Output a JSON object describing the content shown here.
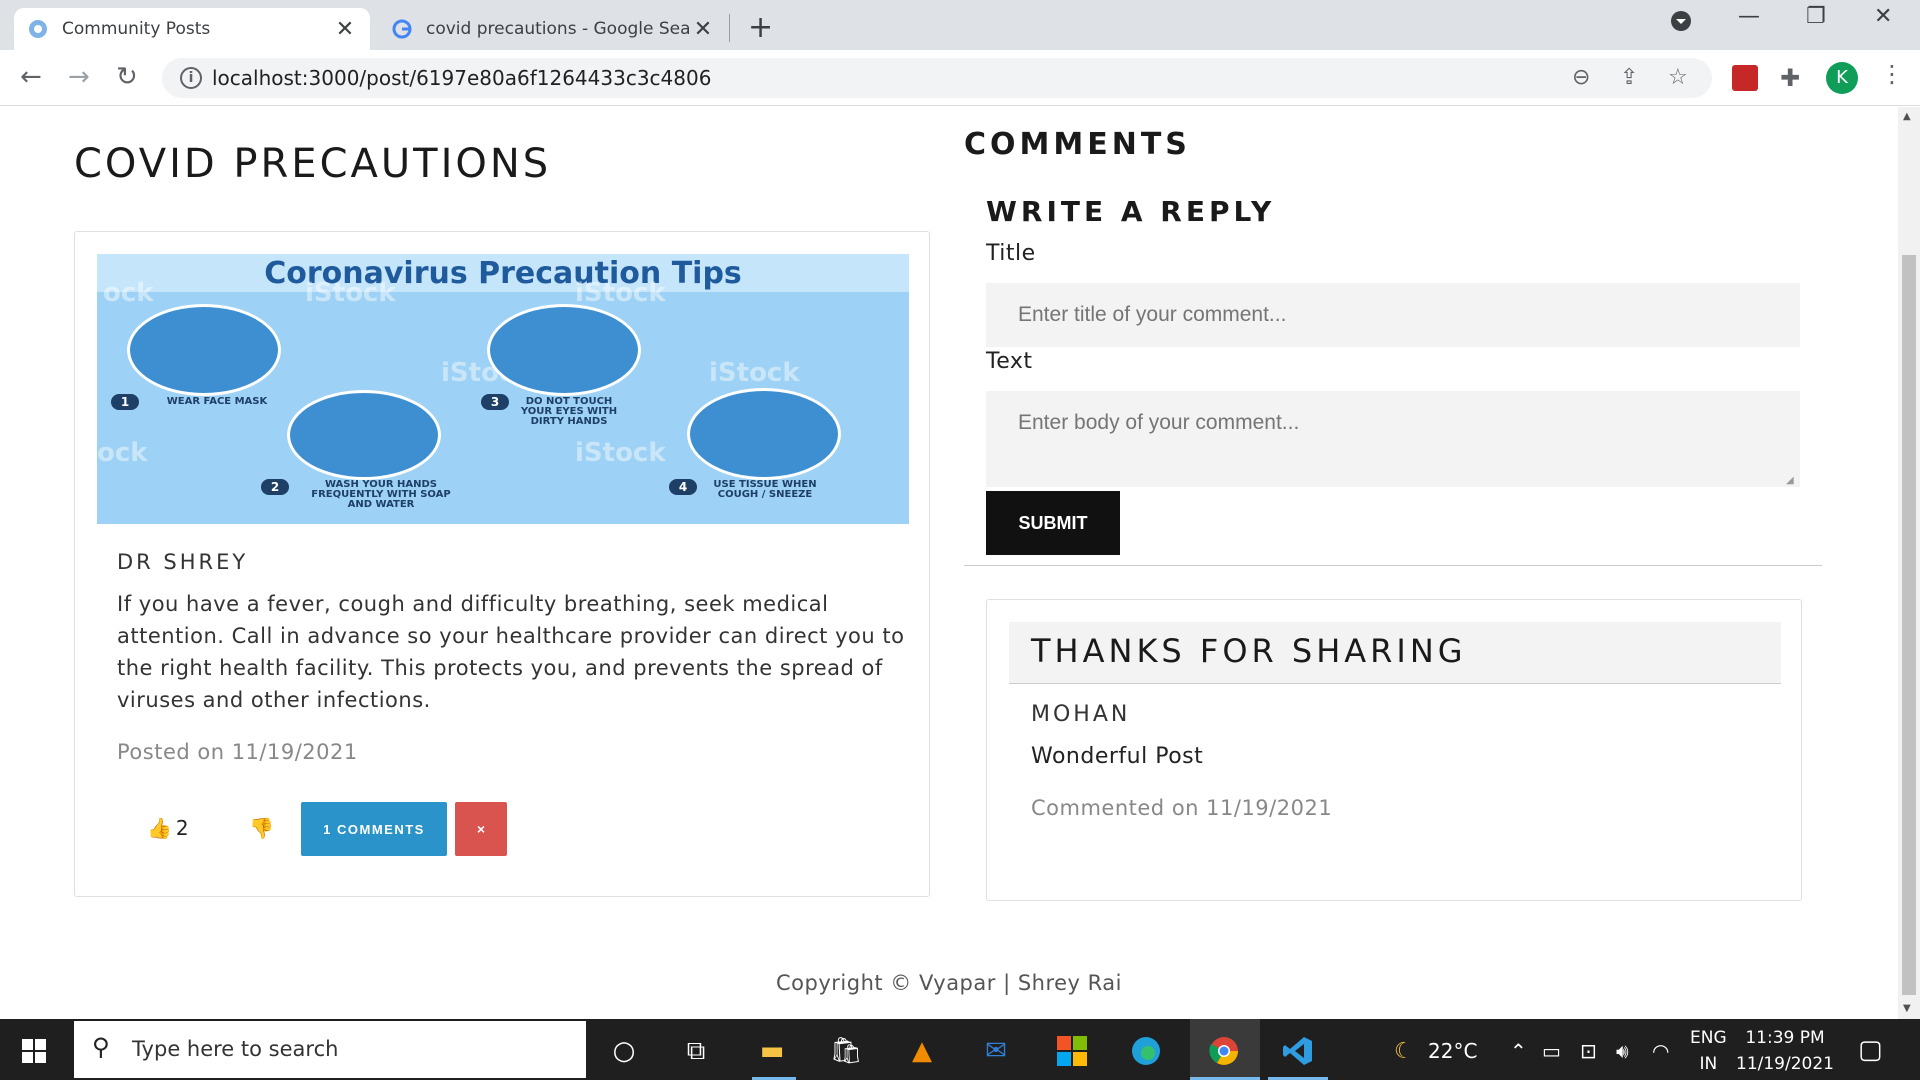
{
  "browser": {
    "tabs": [
      {
        "title": "Community Posts",
        "active": true
      },
      {
        "title": "covid precautions - Google Search",
        "active": false
      }
    ],
    "url": "localhost:3000/post/6197e80a6f1264433c3c4806",
    "profile_initial": "K"
  },
  "post": {
    "title": "COVID PRECAUTIONS",
    "image": {
      "heading": "Coronavirus Precaution Tips",
      "tips": [
        {
          "num": "1",
          "label": "WEAR FACE MASK"
        },
        {
          "num": "2",
          "label": "WASH YOUR HANDS FREQUENTLY WITH SOAP AND WATER"
        },
        {
          "num": "3",
          "label": "DO NOT TOUCH YOUR EYES WITH DIRTY HANDS"
        },
        {
          "num": "4",
          "label": "USE TISSUE WHEN COUGH / SNEEZE"
        }
      ],
      "watermark": "iStock"
    },
    "author": "DR SHREY",
    "body": "If you have a fever, cough and difficulty breathing, seek medical attention. Call in advance so your healthcare provider can direct you to the right health facility. This protects you, and prevents the spread of viruses and other infections.",
    "date": "Posted on 11/19/2021",
    "likes": "2",
    "comments_button": "1 COMMENTS",
    "delete_button": "×"
  },
  "comments": {
    "heading": "COMMENTS",
    "reply_heading": "WRITE A REPLY",
    "title_label": "Title",
    "title_placeholder": "Enter title of your comment...",
    "text_label": "Text",
    "text_placeholder": "Enter body of your comment...",
    "submit_label": "SUBMIT",
    "items": [
      {
        "title": "THANKS FOR SHARING",
        "author": "MOHAN",
        "text": "Wonderful Post",
        "date": "Commented on 11/19/2021"
      }
    ]
  },
  "footer": "Copyright © Vyapar | Shrey Rai",
  "taskbar": {
    "search_placeholder": "Type here to search",
    "temperature": "22°C",
    "language": "ENG",
    "region": "IN",
    "time": "11:39 PM",
    "date": "11/19/2021"
  },
  "colors": {
    "accent": "#2a93c9",
    "danger": "#d9534f",
    "submit": "#111111"
  }
}
